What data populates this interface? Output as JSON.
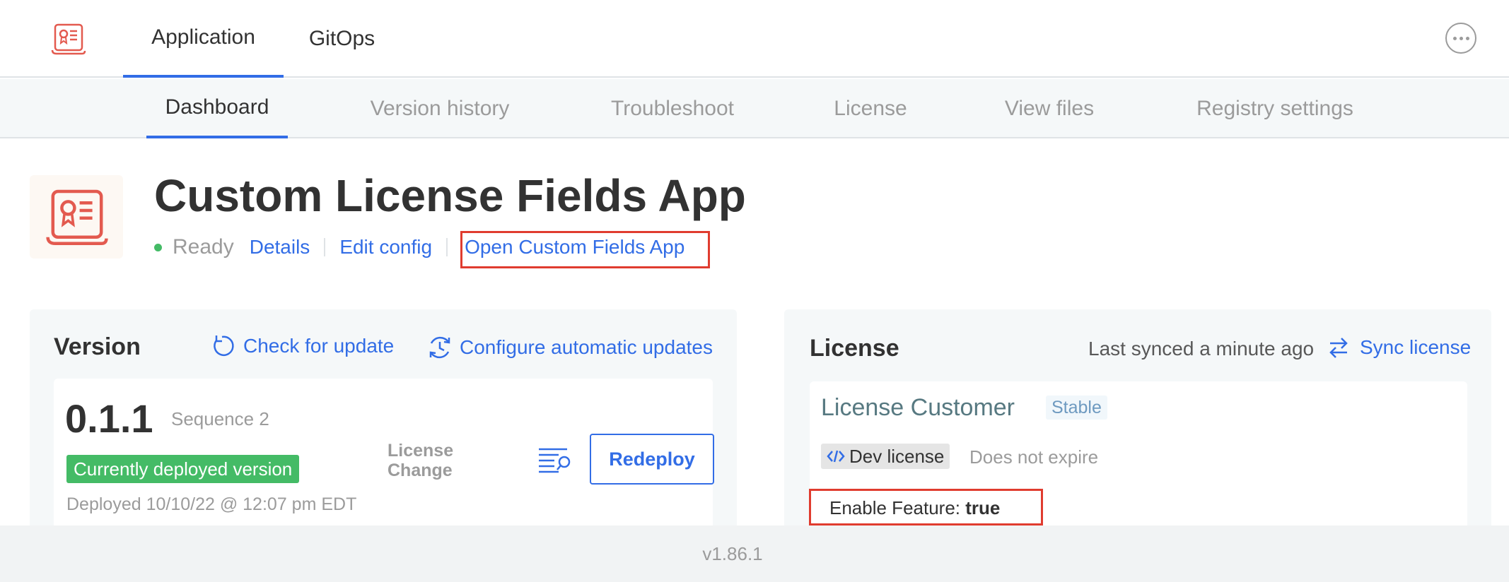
{
  "topnav": {
    "tabs": [
      {
        "label": "Application",
        "active": true
      },
      {
        "label": "GitOps",
        "active": false
      }
    ],
    "more_icon": "more-horizontal-icon"
  },
  "subnav": {
    "tabs": [
      {
        "label": "Dashboard",
        "active": true
      },
      {
        "label": "Version history",
        "active": false
      },
      {
        "label": "Troubleshoot",
        "active": false
      },
      {
        "label": "License",
        "active": false
      },
      {
        "label": "View files",
        "active": false
      },
      {
        "label": "Registry settings",
        "active": false
      }
    ]
  },
  "app": {
    "title": "Custom License Fields App",
    "status": "Ready",
    "links": {
      "details": "Details",
      "edit_config": "Edit config",
      "open_app": "Open Custom Fields App"
    }
  },
  "version_card": {
    "title": "Version",
    "check_update": "Check for update",
    "configure_updates": "Configure automatic updates",
    "version": "0.1.1",
    "sequence": "Sequence 2",
    "deployed_badge": "Currently deployed version",
    "deployed_date": "Deployed 10/10/22 @ 12:07 pm EDT",
    "source": "License Change",
    "redeploy": "Redeploy"
  },
  "license_card": {
    "title": "License",
    "last_synced": "Last synced a minute ago",
    "sync": "Sync license",
    "customer": "License Customer",
    "channel": "Stable",
    "license_type": "Dev license",
    "expiry": "Does not expire",
    "entitlement_label": "Enable Feature:",
    "entitlement_value": "true"
  },
  "footer": {
    "version": "v1.86.1"
  },
  "colors": {
    "accent": "#326de6",
    "success": "#44bb66",
    "highlight": "#e03c2f",
    "icon_red": "#e35a4f"
  }
}
